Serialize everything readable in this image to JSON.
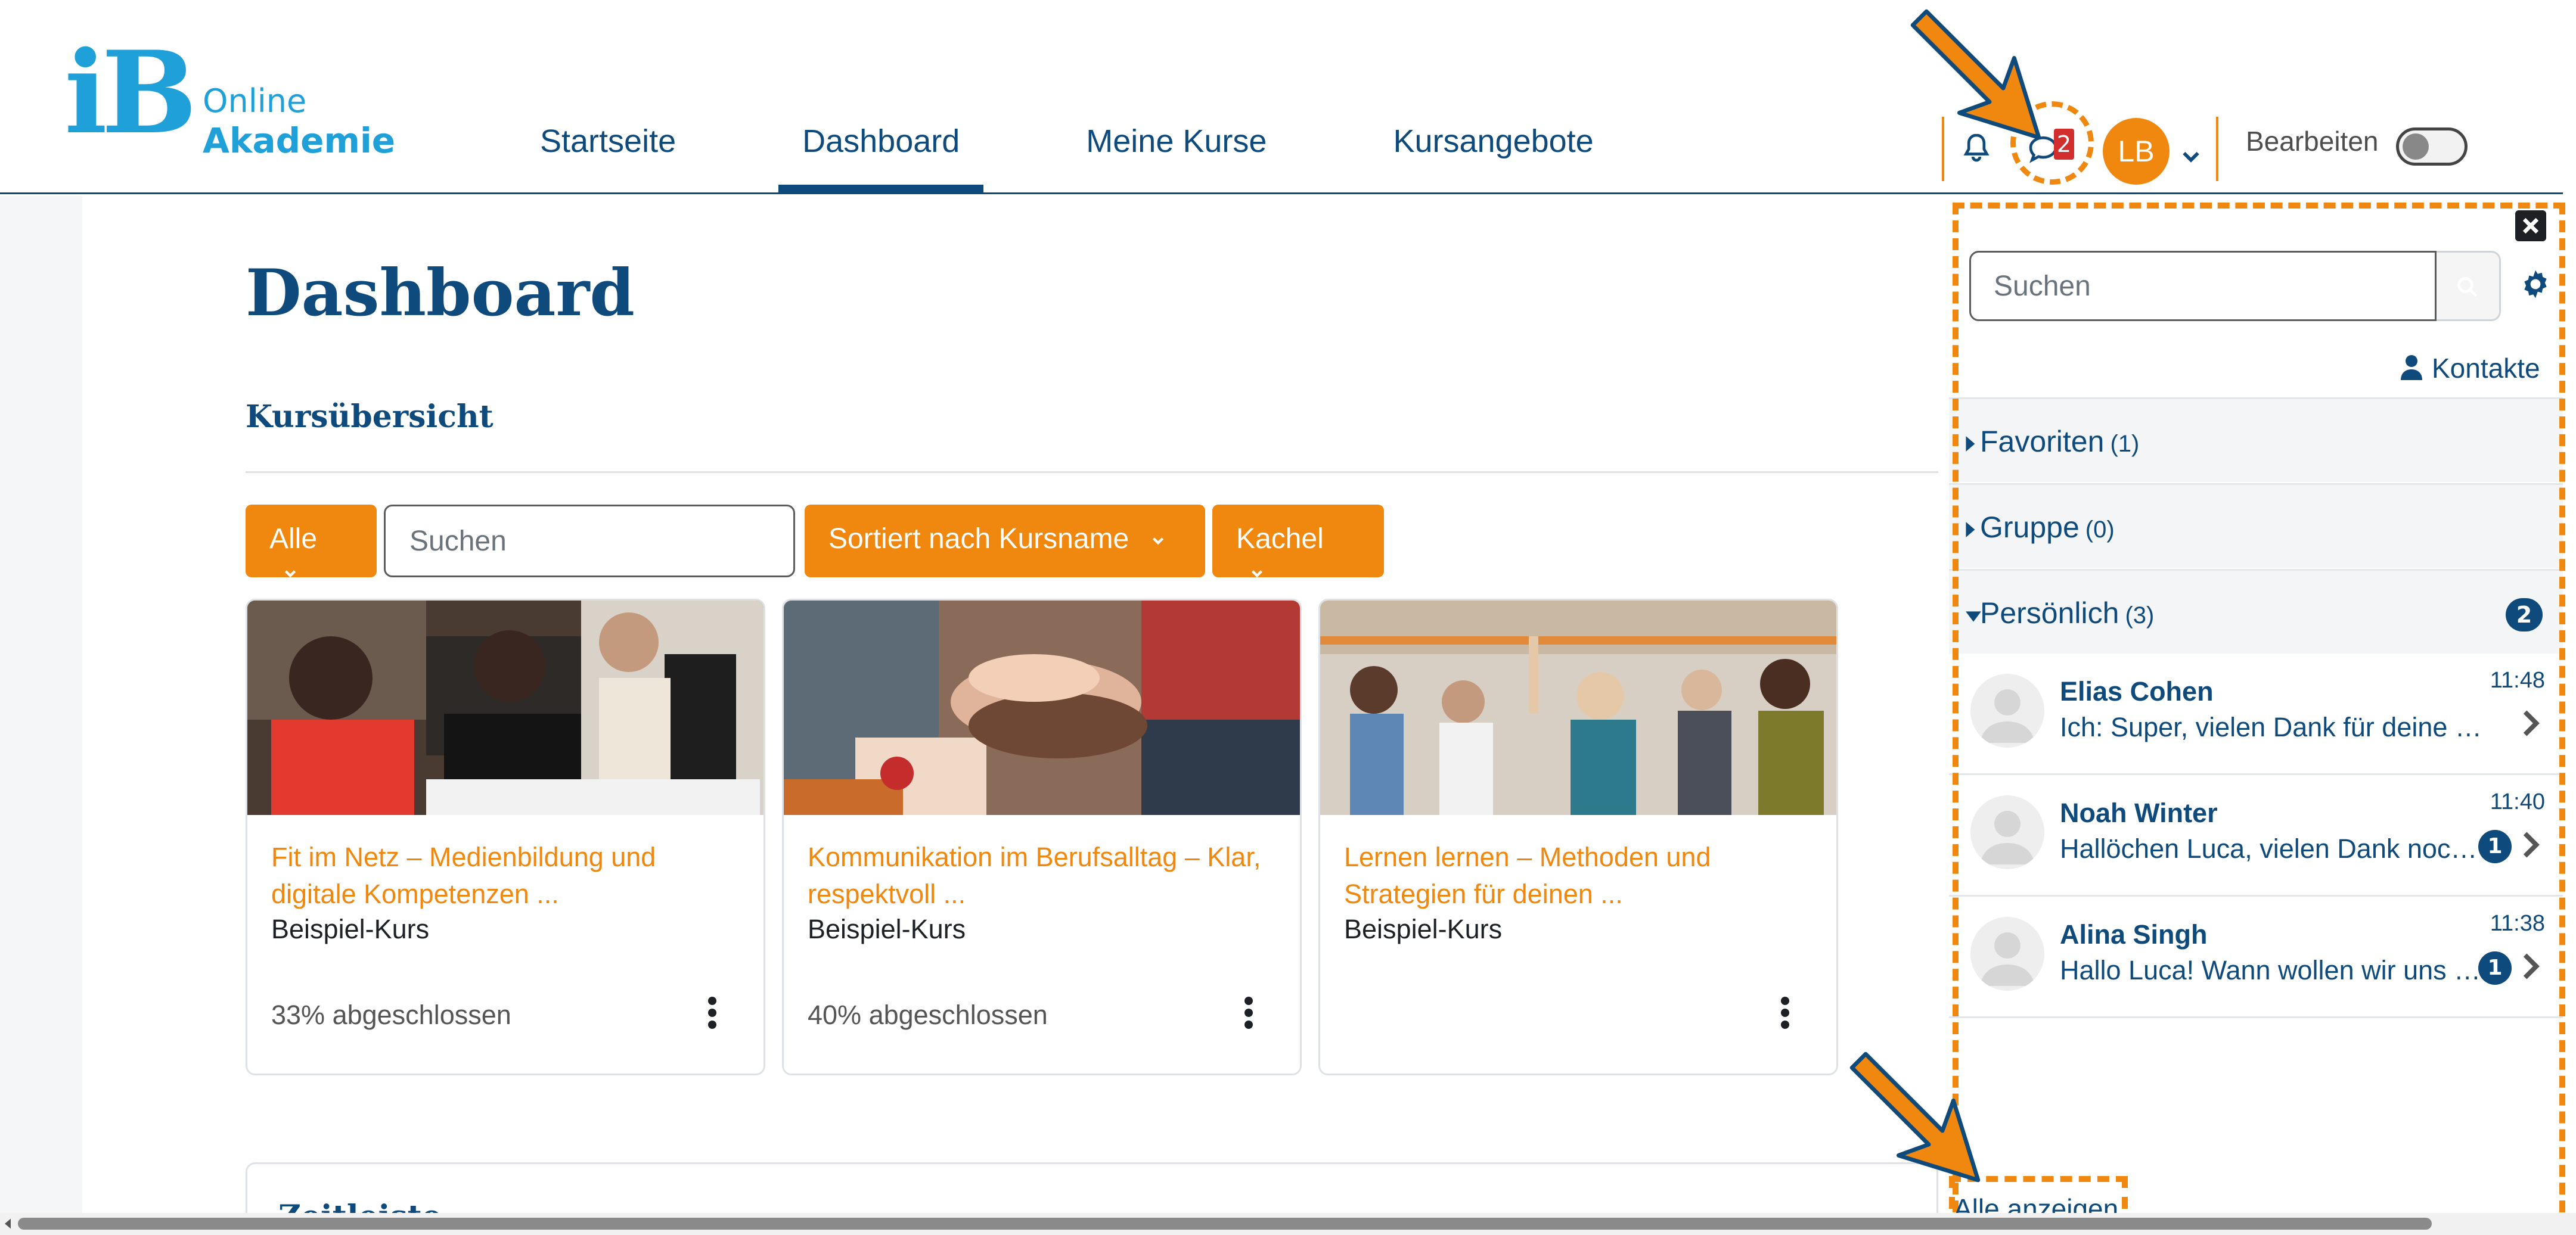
{
  "header": {
    "logo": {
      "ib": "iB",
      "online": "Online",
      "akademie": "Akademie"
    },
    "nav": [
      {
        "label": "Startseite",
        "active": false
      },
      {
        "label": "Dashboard",
        "active": true
      },
      {
        "label": "Meine Kurse",
        "active": false
      },
      {
        "label": "Kursangebote",
        "active": false
      }
    ],
    "icons": {
      "notifications": "bell-icon",
      "messages": "chat-icon"
    },
    "message_badge": "2",
    "user_initials": "LB",
    "edit_label": "Bearbeiten",
    "edit_mode_on": false
  },
  "main": {
    "title": "Dashboard",
    "block_title": "Kursübersicht",
    "filters": {
      "grouping": "Alle",
      "search_placeholder": "Suchen",
      "sort": "Sortiert nach Kursname",
      "view": "Kachel"
    },
    "courses": [
      {
        "title": "Fit im Netz – Medienbildung und digitale Kompetenzen ...",
        "category": "Beispiel-Kurs",
        "progress_text": "33% abgeschlossen",
        "progress_pct": 33
      },
      {
        "title": "Kommunikation im Berufsalltag – Klar, respektvoll ...",
        "category": "Beispiel-Kurs",
        "progress_text": "40% abgeschlossen",
        "progress_pct": 40
      },
      {
        "title": "Lernen lernen – Methoden und Strategien für deinen ...",
        "category": "Beispiel-Kurs",
        "progress_text": "",
        "progress_pct": null
      }
    ],
    "timeline_title": "Zeitleiste"
  },
  "drawer": {
    "search_placeholder": "Suchen",
    "contacts_label": "Kontakte",
    "sections": {
      "favorites": {
        "label": "Favoriten",
        "count": "(1)"
      },
      "group": {
        "label": "Gruppe",
        "count": "(0)"
      },
      "personal": {
        "label": "Persönlich",
        "count": "(3)",
        "unread": "2"
      }
    },
    "conversations": [
      {
        "name": "Elias Cohen",
        "message": "Ich: Super, vielen Dank für deine Hilfe!",
        "time": "11:48",
        "unread": ""
      },
      {
        "name": "Noah Winter",
        "message": "Hallöchen Luca, vielen Dank noch einmal",
        "time": "11:40",
        "unread": "1"
      },
      {
        "name": "Alina Singh",
        "message": "Hallo Luca! Wann wollen wir uns treffen?",
        "time": "11:38",
        "unread": "1"
      }
    ],
    "show_all": "Alle anzeigen"
  },
  "colors": {
    "brand_blue": "#0f4a7c",
    "logo_blue": "#1fa0d9",
    "accent_orange": "#f0880f",
    "badge_red": "#d22e2e"
  }
}
